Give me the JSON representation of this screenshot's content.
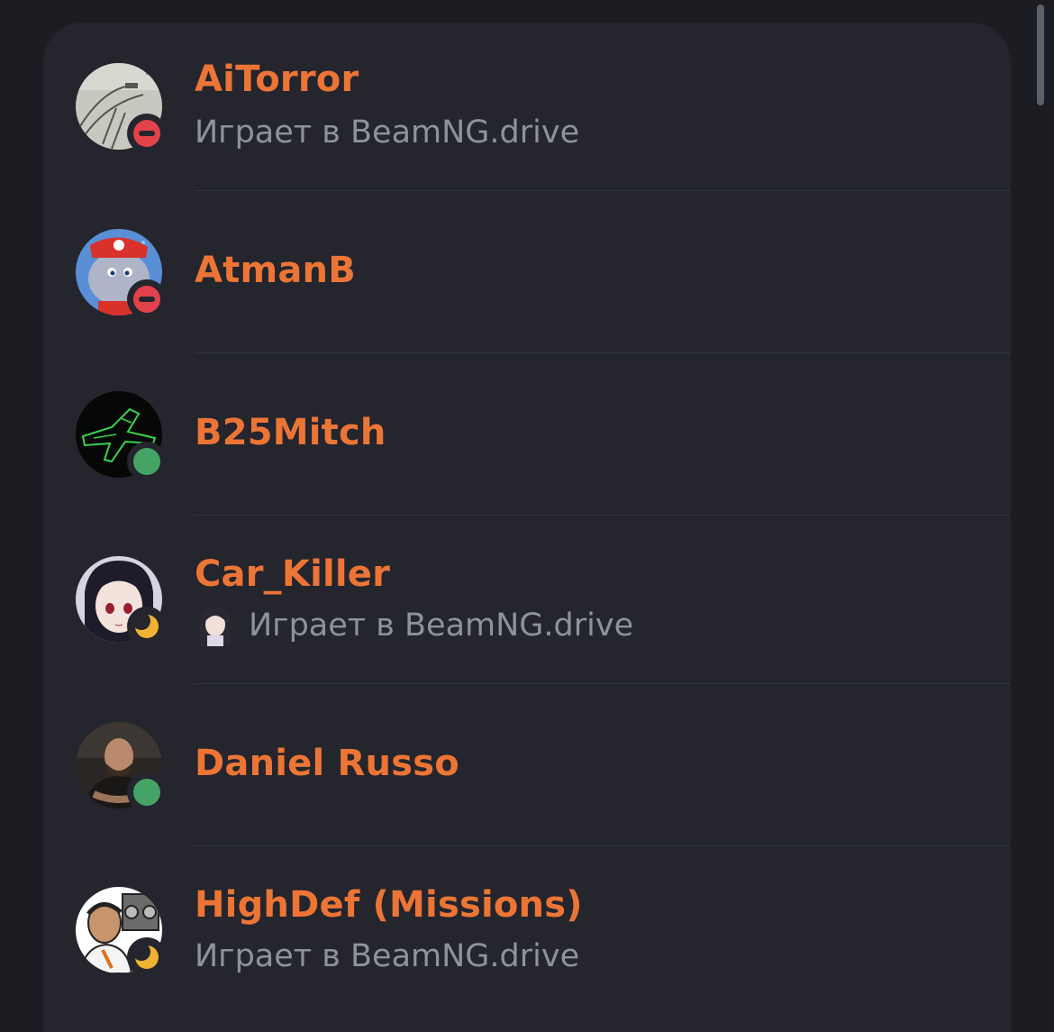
{
  "colors": {
    "background": "#1c1d22",
    "panel": "#24252d",
    "name": "#ec7536",
    "activity_text": "#8f929c",
    "status_online": "#45a366",
    "status_dnd": "#e2424b",
    "status_idle": "#f0b232"
  },
  "members": [
    {
      "name": "AiTorror",
      "activity": "Играет в BeamNG.drive",
      "status": "dnd",
      "avatar": "road-drawing-avatar",
      "has_activity_icon": false
    },
    {
      "name": "AtmanB",
      "activity": "",
      "status": "dnd",
      "avatar": "elephant-mario-avatar",
      "has_activity_icon": false
    },
    {
      "name": "B25Mitch",
      "activity": "",
      "status": "online",
      "avatar": "green-plane-avatar",
      "has_activity_icon": false
    },
    {
      "name": "Car_Killer",
      "activity": "Играет в BeamNG.drive",
      "status": "idle",
      "avatar": "anime-girl-avatar",
      "has_activity_icon": true,
      "activity_icon": "anime-girl-icon"
    },
    {
      "name": "Daniel Russo",
      "activity": "",
      "status": "online",
      "avatar": "man-portrait-avatar",
      "has_activity_icon": false
    },
    {
      "name": "HighDef (Missions)",
      "activity": "Играет в BeamNG.drive",
      "status": "idle",
      "avatar": "cartoon-man-avatar",
      "has_activity_icon": false
    }
  ]
}
